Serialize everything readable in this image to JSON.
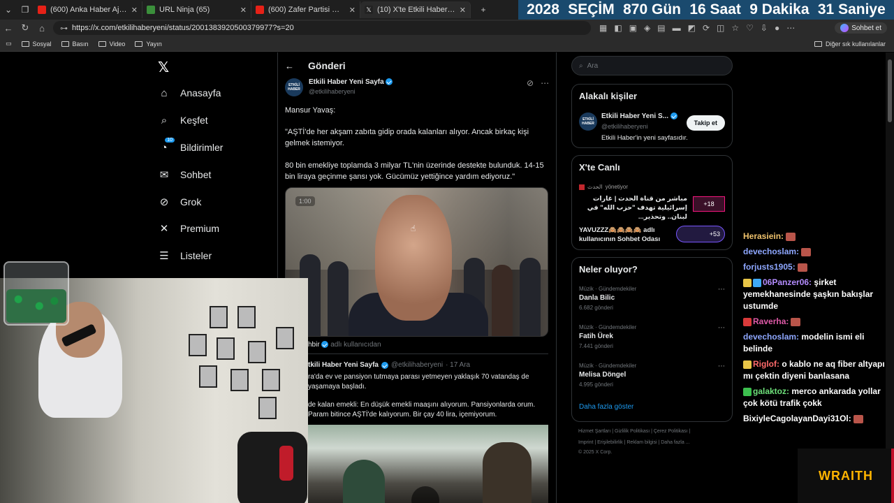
{
  "browser": {
    "tabs": [
      {
        "label": "(600) Anka Haber Ajansı - YouTube",
        "fav": "#e62117",
        "active": false
      },
      {
        "label": "URL Ninja (65)",
        "fav": "#3b8f3b",
        "active": false
      },
      {
        "label": "(600) Zafer Partisi Genel Başkanı Ü",
        "fav": "#e62117",
        "active": false
      },
      {
        "label": "(10) X'te Etkili Haber Yeni Sayfa",
        "fav": "#222222",
        "active": true
      }
    ],
    "url": "https://x.com/etkilihaberyeni/status/2001383920500379977?s=20",
    "chat_button": "Sohbet et",
    "bookmarks": [
      "Sosyal",
      "Basın",
      "Video",
      "Yayın"
    ],
    "other_bookmarks": "Diğer sık kullanılanlar"
  },
  "countdown": {
    "year": "2028",
    "label": "SEÇİM",
    "days": "870 Gün",
    "hours": "16 Saat",
    "minutes": "9 Dakika",
    "seconds": "31 Saniye"
  },
  "nav": {
    "items": [
      {
        "label": "Anasayfa",
        "icon": "home-icon",
        "glyph": "⌂"
      },
      {
        "label": "Keşfet",
        "icon": "search-icon",
        "glyph": "⌕"
      },
      {
        "label": "Bildirimler",
        "icon": "bell-icon",
        "glyph": "🔔",
        "badge": "10"
      },
      {
        "label": "Sohbet",
        "icon": "mail-icon",
        "glyph": "✉"
      },
      {
        "label": "Grok",
        "icon": "grok-icon",
        "glyph": "⊘"
      },
      {
        "label": "Premium",
        "icon": "x-icon",
        "glyph": "✕"
      },
      {
        "label": "Listeler",
        "icon": "list-icon",
        "glyph": "☰"
      }
    ]
  },
  "post": {
    "header": "Gönderi",
    "author_name": "Etkili Haber Yeni Sayfa",
    "author_handle": "@etkilihaberyeni",
    "avatar_text": "ETKİLİ HABER",
    "lines": [
      "Mansur Yavaş:",
      "\"AŞTİ'de her akşam zabıta gidip orada kalanları alıyor. Ancak birkaç kişi gelmek istemiyor.",
      "80 bin emekliye toplamda 3 milyar TL'nin üzerinde destekte bulunduk. 14-15 bin liraya geçinme şansı yok. Gücümüz yettiğince yardım ediyoruz.\""
    ],
    "video_time": "1:00",
    "reposted_by": "hbir",
    "reposted_suffix": "adlı kullanıcıdan"
  },
  "quote": {
    "name": "tkili Haber Yeni Sayfa",
    "handle": "@etkilihaberyeni",
    "date": "· 17 Ara",
    "line1": "ra'da ev ve pansiyon tutmaya parası yetmeyen yaklaşık 70 vatandaş de yaşamaya başladı.",
    "line2": "de kalan emekli: En düşük emekli maaşını alıyorum. Pansiyonlarda orum. Param bitince AŞTİ'de kalıyorum. Bir çay 40 lira, içemiyorum."
  },
  "right": {
    "search_placeholder": "Ara",
    "related_title": "Alakalı kişiler",
    "related_name": "Etkili Haber Yeni S...",
    "related_handle": "@etkilihaberyeni",
    "related_bio": "Etkili Haber'in yeni sayfasıdır.",
    "follow_label": "Takip et",
    "live_title": "X'te Canlı",
    "live1_host": "الحدث",
    "live1_role": "yönetiyor",
    "live1_text": "مباشر من قناة الحدث | غارات إسرائيلية تهدف \"حزب الله\" في لبنان.. وتحذير...",
    "live1_count": "+18",
    "live2_text": "YAVUZZZ🙈🙈🙈🙈 adlı kullanıcının Sohbet Odası",
    "live2_count": "+53",
    "trends_title": "Neler oluyor?",
    "trends": [
      {
        "cat": "Müzik · Gündemdekiler",
        "name": "Danla Bilic",
        "count": "6.682 gönderi"
      },
      {
        "cat": "Müzik · Gündemdekiler",
        "name": "Fatih Ürek",
        "count": "7.441 gönderi"
      },
      {
        "cat": "Müzik · Gündemdekiler",
        "name": "Melisa Döngel",
        "count": "4.995 gönderi"
      }
    ],
    "show_more": "Daha fazla göster",
    "footer1": "Hizmet Şartları  |  Gizlilik Politikası  |  Çerez Politikası  |",
    "footer2": "Imprint  |  Erişilebilirlik  |  Reklam bilgisi  |  Daha fazla ...",
    "footer3": "© 2025 X Corp."
  },
  "chat": [
    {
      "user": "Herasiein:",
      "msg": "",
      "color": "#f0c36d"
    },
    {
      "user": "devechoslam:",
      "msg": "",
      "color": "#8ea7ff"
    },
    {
      "user": "forjusts1905:",
      "msg": "",
      "color": "#8ea7ff"
    },
    {
      "user": "06Panzer06:",
      "msg": "şirket yemekhanesinde şaşkın bakışlar ustumde",
      "color": "#b48cff"
    },
    {
      "user": "Raverha:",
      "msg": "",
      "color": "#e05aa8"
    },
    {
      "user": "devechoslam:",
      "msg": "modelin ismi eli belinde",
      "color": "#8ea7ff"
    },
    {
      "user": "Riglof:",
      "msg": "o kablo ne aq fiber altyapı mı çektin diyeni banlasana",
      "color": "#ff6b6b"
    },
    {
      "user": "galaktoz:",
      "msg": "merco ankarada yollar çok kötü trafik çokk",
      "color": "#6ee07a"
    },
    {
      "user": "BixiyleCagolayanDayi31Ol:",
      "msg": "",
      "color": "#ffffff"
    }
  ],
  "overlay": {
    "brand": "WRAITH"
  }
}
